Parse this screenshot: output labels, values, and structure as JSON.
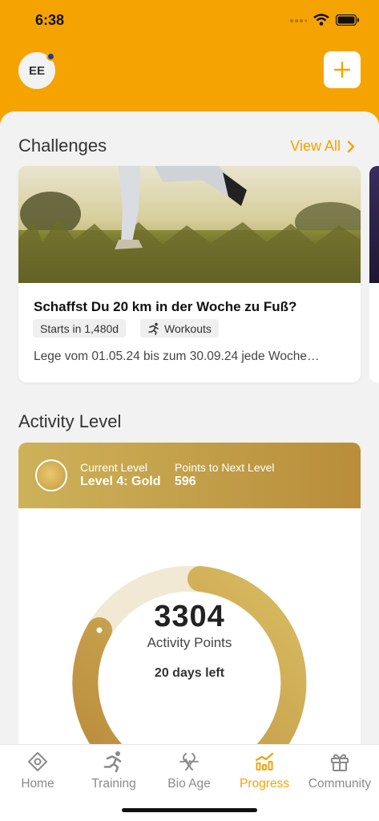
{
  "status_bar": {
    "time": "6:38"
  },
  "header": {
    "avatar_initials": "EE"
  },
  "challenges": {
    "title": "Challenges",
    "view_all": "View All",
    "card": {
      "title": "Schaffst Du 20 km in der Woche zu Fuß?",
      "tag_start": "Starts in 1,480d",
      "tag_type": "Workouts",
      "description": "Lege vom 01.05.24 bis zum 30.09.24 jede Woche…"
    }
  },
  "activity": {
    "title": "Activity Level",
    "current_level_label": "Current Level",
    "current_level_value": "Level 4: Gold",
    "next_level_label": "Points to Next Level",
    "next_level_value": "596",
    "points": "3304",
    "points_label": "Activity Points",
    "days_left": "20 days left"
  },
  "tabs": [
    {
      "label": "Home",
      "icon": "home-icon",
      "active": false
    },
    {
      "label": "Training",
      "icon": "runner-icon",
      "active": false
    },
    {
      "label": "Bio Age",
      "icon": "bio-age-icon",
      "active": false
    },
    {
      "label": "Progress",
      "icon": "chart-icon",
      "active": true
    },
    {
      "label": "Community",
      "icon": "gift-icon",
      "active": false
    }
  ],
  "colors": {
    "accent": "#f5a300",
    "gold": "#c49a3c",
    "track": "#f0e8d2"
  }
}
